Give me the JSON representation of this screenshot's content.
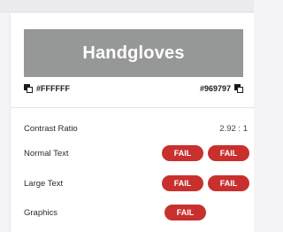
{
  "preview": {
    "sample_text": "Handgloves",
    "background_color": "#969797",
    "text_color": "#FFFFFF"
  },
  "colors": {
    "foreground_hex": "#FFFFFF",
    "background_hex": "#969797",
    "fail_color": "#c8302e"
  },
  "contrast": {
    "label": "Contrast Ratio",
    "value": "2.92 : 1"
  },
  "checks": {
    "normal_text": {
      "label": "Normal Text",
      "results": [
        "FAIL",
        "FAIL"
      ]
    },
    "large_text": {
      "label": "Large Text",
      "results": [
        "FAIL",
        "FAIL"
      ]
    },
    "graphics": {
      "label": "Graphics",
      "results": [
        "FAIL"
      ]
    }
  }
}
